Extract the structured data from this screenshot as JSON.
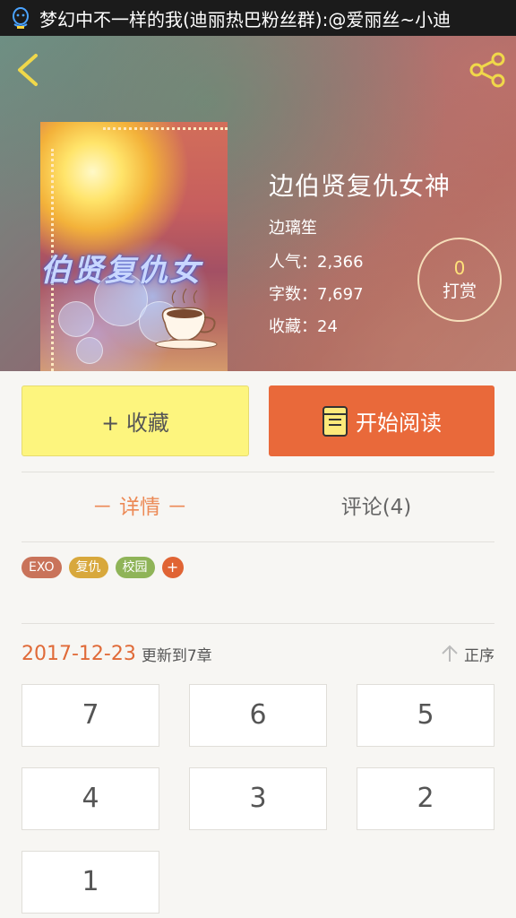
{
  "status_bar": {
    "notification": "梦幻中不一样的我(迪丽热巴粉丝群):@爱丽丝~小迪"
  },
  "header": {
    "back_icon": "chevron-left-icon",
    "share_icon": "share-icon"
  },
  "book": {
    "cover_title": "伯贤复仇女",
    "title": "边伯贤复仇女神",
    "author": "边璃笙",
    "popularity_label": "人气：",
    "popularity": "2,366",
    "words_label": "字数：",
    "words": "7,697",
    "favorites_label": "收藏：",
    "favorites": "24"
  },
  "tip": {
    "count": "0",
    "label": "打赏"
  },
  "actions": {
    "collect_label": "+ 收藏",
    "read_label": "开始阅读"
  },
  "tabs": {
    "detail_label": "－ 详情 －",
    "comments_label": "评论(4)"
  },
  "tags": [
    {
      "label": "EXO",
      "color": "#c9735a"
    },
    {
      "label": "复仇",
      "color": "#d8a83c"
    },
    {
      "label": "校园",
      "color": "#8fb458"
    }
  ],
  "tag_add_label": "+",
  "update": {
    "date": "2017-12-23",
    "text": "更新到7章",
    "sort_label": "正序"
  },
  "chapters": [
    "7",
    "6",
    "5",
    "4",
    "3",
    "2",
    "1"
  ],
  "colors": {
    "accent_orange": "#e9693a",
    "collect_yellow": "#fdf57e",
    "date_orange": "#e06a38"
  }
}
